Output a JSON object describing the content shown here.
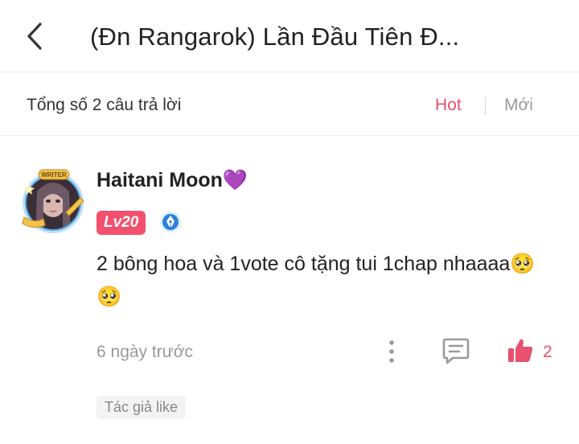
{
  "header": {
    "title": "(Đn Rangarok) Lần Đầu Tiên Đ...",
    "back_icon": "chevron-left-icon"
  },
  "subbar": {
    "total_label": "Tổng số 2 câu trả lời",
    "sort_hot": "Hot",
    "sort_new": "Mới"
  },
  "comment": {
    "avatar_badge_text": "WRITER",
    "username": "Haitani Moon💜",
    "level": "Lv20",
    "text": "2 bông hoa và 1vote cô tặng tui 1chap nhaaaa🥺🥺",
    "timestamp": "6 ngày trước",
    "like_count": "2",
    "author_tag": "Tác giả like"
  },
  "colors": {
    "accent": "#e8506f",
    "level_badge": "#f2506e",
    "writer_badge": "#2f7fd6",
    "muted_text": "#999999",
    "icon_gray": "#9a9a9a"
  }
}
